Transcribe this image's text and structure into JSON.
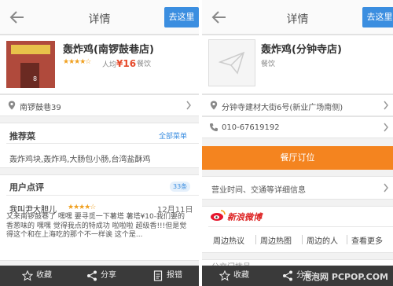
{
  "left": {
    "header": {
      "title": "详情",
      "goto_label": "去这里"
    },
    "shop": {
      "name": "轰炸鸡(南锣鼓巷店)",
      "stars": "★★★★☆",
      "avg_label": "人均",
      "avg_price": "¥16",
      "category": "餐饮",
      "photo_number": "8"
    },
    "address": "南锣鼓巷39",
    "recommended": {
      "title": "推荐菜",
      "all_menu_link": "全部菜单",
      "dishes": "轰炸鸡块,轰炸鸡,大肠包小肠,台湾盐酥鸡"
    },
    "reviews": {
      "title": "用户点评",
      "count": "33条",
      "user": "我叫尹大胆儿",
      "stars": "★★★★☆",
      "date": "12月11日",
      "body": "又来南锣鼓巷了 嘿嘿 要寻觅一下薯塔 薯塔¥10-我们要的香葱味的 嘿嘿 觉得我点的特成功 啦啦啦 超级香!!!但是觉得这个和在上海吃的那个不一样诶 这个是..."
    },
    "tabbar": {
      "collect": "收藏",
      "share": "分享",
      "report": "报错"
    }
  },
  "right": {
    "header": {
      "title": "详情",
      "goto_label": "去这里"
    },
    "shop": {
      "name": "轰炸鸡(分钟寺店)",
      "category": "餐饮"
    },
    "address": "分钟寺建材大街6号(新业广场南侧)",
    "phone": "010-67619192",
    "order_button": "餐厅订位",
    "hours_label": "营业时间、交通等详细信息",
    "weibo": {
      "logo_text": "新浪微博",
      "tabs": [
        "周边热议",
        "周边热图",
        "周边的人",
        "查看更多"
      ]
    },
    "partial_section": "公交门槛号",
    "tabbar": {
      "collect": "收藏",
      "share": "分享"
    }
  },
  "watermark": "泡泡网 PCPOP.COM",
  "colors": {
    "accent_blue": "#3b8ee0",
    "order_orange": "#f4841f",
    "price_red": "#e64a2b",
    "star_gold": "#f0a020",
    "tabbar_dark": "#3a3a3a"
  }
}
